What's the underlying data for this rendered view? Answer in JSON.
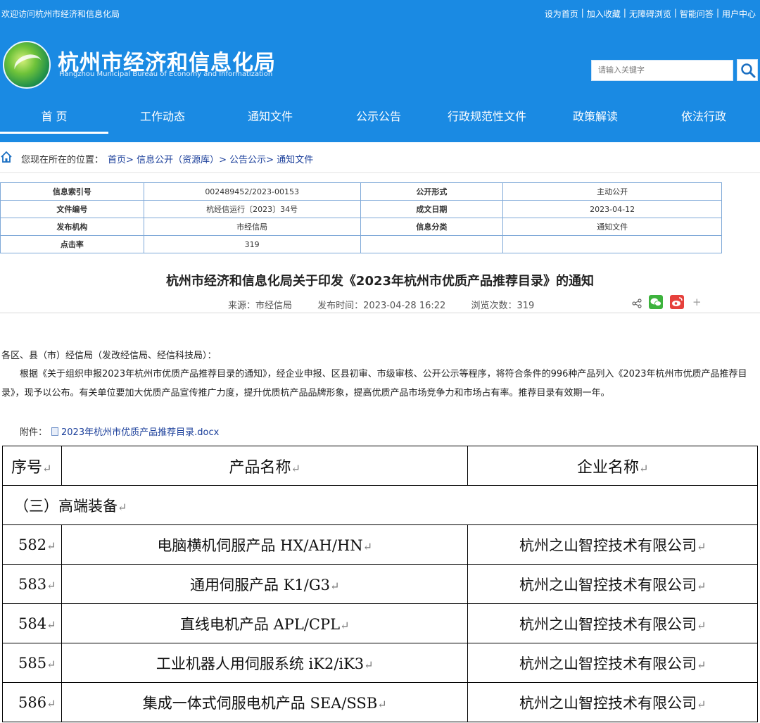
{
  "topbar": {
    "welcome": "欢迎访问杭州市经济和信息化局",
    "links": [
      "设为首页",
      "加入收藏",
      "无障碍浏览",
      "智能问答",
      "用户中心"
    ]
  },
  "site": {
    "title": "杭州市经济和信息化局",
    "subtitle": "Hangzhou Municipal Bureau of Economy and Informatization"
  },
  "search": {
    "placeholder": "请输入关键字"
  },
  "nav": [
    "首 页",
    "工作动态",
    "通知文件",
    "公示公告",
    "行政规范性文件",
    "政策解读",
    "依法行政"
  ],
  "breadcrumb": {
    "label": "您现在所在的位置：",
    "items": [
      "首页",
      "信息公开（资源库）",
      "公告公示",
      "通知文件"
    ],
    "separator": ">"
  },
  "meta": {
    "index_label": "信息索引号",
    "index_value": "002489452/2023-00153",
    "public_label": "公开形式",
    "public_value": "主动公开",
    "docno_label": "文件编号",
    "docno_value": "杭经信运行〔2023〕34号",
    "date_label": "成文日期",
    "date_value": "2023-04-12",
    "org_label": "发布机构",
    "org_value": "市经信局",
    "category_label": "信息分类",
    "category_value": "通知文件",
    "clicks_label": "点击率",
    "clicks_value": "319"
  },
  "article": {
    "title": "杭州市经济和信息化局关于印发《2023年杭州市优质产品推荐目录》的通知",
    "source": "来源：市经信局",
    "publish_time": "发布时间：2023-04-28 16:22",
    "views": "浏览次数：319",
    "greeting": "各区、县（市）经信局（发改经信局、经信科技局）：",
    "body": "根据《关于组织申报2023年杭州市优质产品推荐目录的通知》，经企业申报、区县初审、市级审核、公开公示等程序，将符合条件的996种产品列入《2023年杭州市优质产品推荐目录》，现予以公布。有关单位要加大优质产品宣传推广力度，提升优质杭产品品牌形象，提高优质产品市场竞争力和市场占有率。推荐目录有效期一年。",
    "attachment_label": "附件：",
    "attachment_file": "2023年杭州市优质产品推荐目录.docx"
  },
  "product_table": {
    "headers": [
      "序号",
      "产品名称",
      "企业名称"
    ],
    "mark": "↵",
    "section": "（三）高端装备",
    "rows": [
      {
        "no": "582",
        "product": "电脑横机伺服产品 HX/AH/HN",
        "company": "杭州之山智控技术有限公司"
      },
      {
        "no": "583",
        "product": "通用伺服产品 K1/G3",
        "company": "杭州之山智控技术有限公司"
      },
      {
        "no": "584",
        "product": "直线电机产品 APL/CPL",
        "company": "杭州之山智控技术有限公司"
      },
      {
        "no": "585",
        "product": "工业机器人用伺服系统 iK2/iK3",
        "company": "杭州之山智控技术有限公司"
      },
      {
        "no": "586",
        "product": "集成一体式伺服电机产品 SEA/SSB",
        "company": "杭州之山智控技术有限公司"
      }
    ]
  },
  "colors": {
    "header_blue": "#1a8ae3",
    "link_blue": "#1a3e9a",
    "meta_border": "#7fa9d8"
  }
}
